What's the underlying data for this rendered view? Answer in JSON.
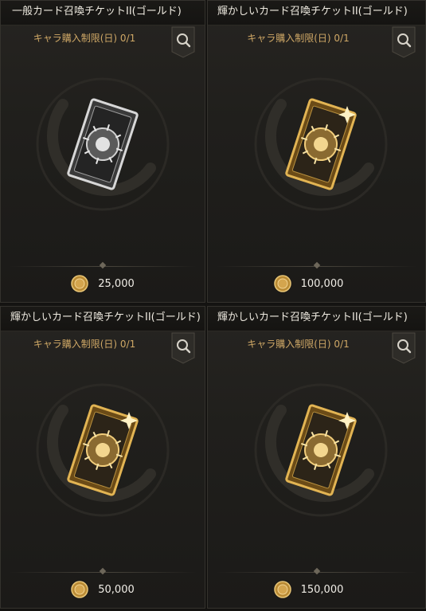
{
  "items": [
    {
      "title": "一般カード召喚チケットII(ゴールド)",
      "limit": "キャラ購入制限(日) 0/1",
      "price": "25,000",
      "variant": "silver"
    },
    {
      "title": "輝かしいカード召喚チケットII(ゴールド)",
      "limit": "キャラ購入制限(日) 0/1",
      "price": "100,000",
      "variant": "gold"
    },
    {
      "title": "輝かしいカード召喚チケットII(ゴールド)",
      "limit": "キャラ購入制限(日) 0/1",
      "price": "50,000",
      "variant": "gold"
    },
    {
      "title": "輝かしいカード召喚チケットII(ゴールド)",
      "limit": "キャラ購入制限(日) 0/1",
      "price": "150,000",
      "variant": "gold"
    }
  ],
  "icons": {
    "search": "magnifier-icon",
    "currency": "gold-coin-icon"
  },
  "colors": {
    "title_text": "#eeeae0",
    "limit_text": "#cfa866",
    "gold": "#d9aa4a",
    "silver": "#c9c9c9"
  }
}
